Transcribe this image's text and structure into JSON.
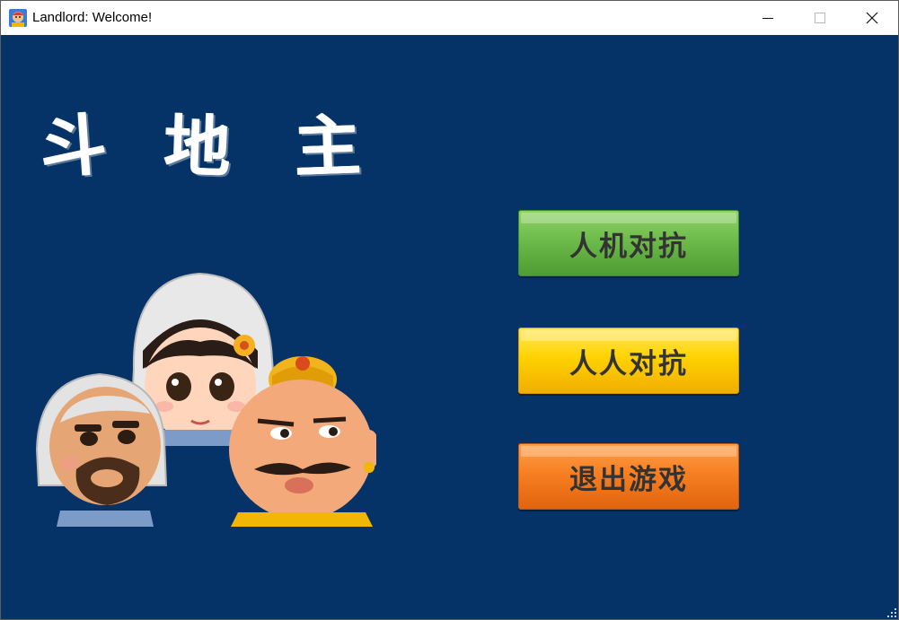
{
  "window": {
    "title": "Landlord: Welcome!",
    "controls": [
      "minimize-icon",
      "maximize-icon",
      "close-icon"
    ]
  },
  "game": {
    "title_chars": [
      "斗",
      "地",
      "主"
    ],
    "illustration": "three-cartoon-characters",
    "background_color": "#063367"
  },
  "menu": {
    "pve_label": "人机对抗",
    "pvp_label": "人人对抗",
    "exit_label": "退出游戏",
    "colors": {
      "pve": "#6dbb4a",
      "pvp": "#ffd200",
      "exit": "#f77f22"
    }
  }
}
